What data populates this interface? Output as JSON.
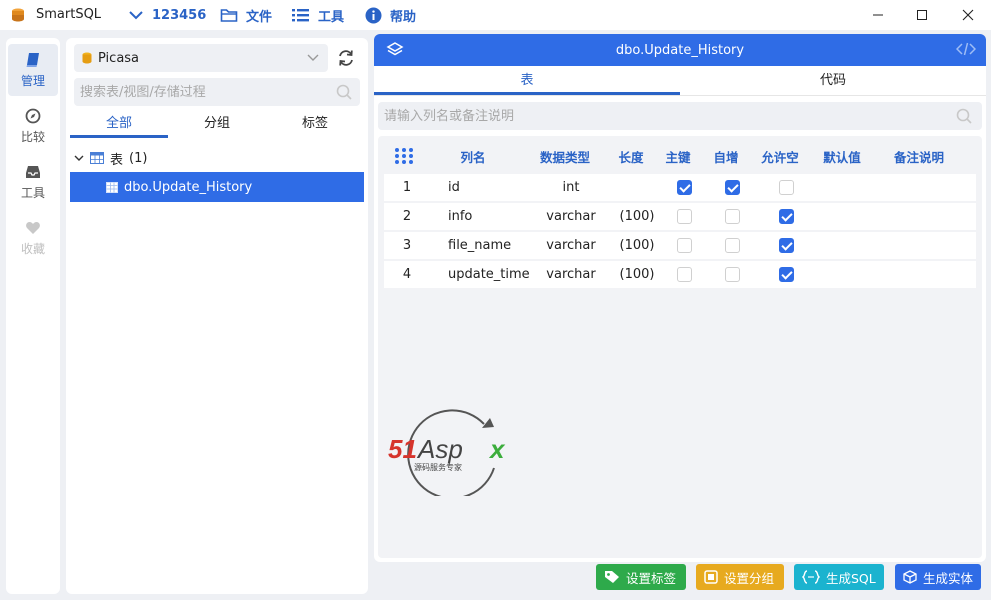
{
  "app": {
    "name": "SmartSQL"
  },
  "menu": {
    "connection": "123456",
    "file": "文件",
    "tools": "工具",
    "help": "帮助"
  },
  "nav": {
    "manage": "管理",
    "compare": "比较",
    "tools": "工具",
    "favorites": "收藏"
  },
  "db": {
    "name": "Picasa"
  },
  "object_search": {
    "placeholder": "搜索表/视图/存储过程"
  },
  "object_tabs": [
    "全部",
    "分组",
    "标签"
  ],
  "tree": {
    "group_label": "表",
    "group_count": "(1)",
    "selected_item": "dbo.Update_History"
  },
  "detail": {
    "title": "dbo.Update_History",
    "tabs": [
      "表",
      "代码"
    ],
    "search_placeholder": "请输入列名或备注说明",
    "columns": [
      "列名",
      "数据类型",
      "长度",
      "主键",
      "自增",
      "允许空",
      "默认值",
      "备注说明"
    ],
    "rows": [
      {
        "no": "1",
        "name": "id",
        "type": "int",
        "length": "",
        "pk": true,
        "identity": true,
        "nullable": false
      },
      {
        "no": "2",
        "name": "info",
        "type": "varchar",
        "length": "(100)",
        "pk": false,
        "identity": false,
        "nullable": true
      },
      {
        "no": "3",
        "name": "file_name",
        "type": "varchar",
        "length": "(100)",
        "pk": false,
        "identity": false,
        "nullable": true
      },
      {
        "no": "4",
        "name": "update_time",
        "type": "varchar",
        "length": "(100)",
        "pk": false,
        "identity": false,
        "nullable": true
      }
    ]
  },
  "watermark": {
    "brand": "51Aspx",
    "slogan": "源码服务专家"
  },
  "buttons": {
    "set_tag": "设置标签",
    "set_group": "设置分组",
    "gen_sql": "生成SQL",
    "gen_entity": "生成实体"
  },
  "colors": {
    "accent": "#2f6ce6",
    "green": "#2eaa4b",
    "yellow": "#e7aa1f",
    "cyan": "#1bb3cf"
  }
}
